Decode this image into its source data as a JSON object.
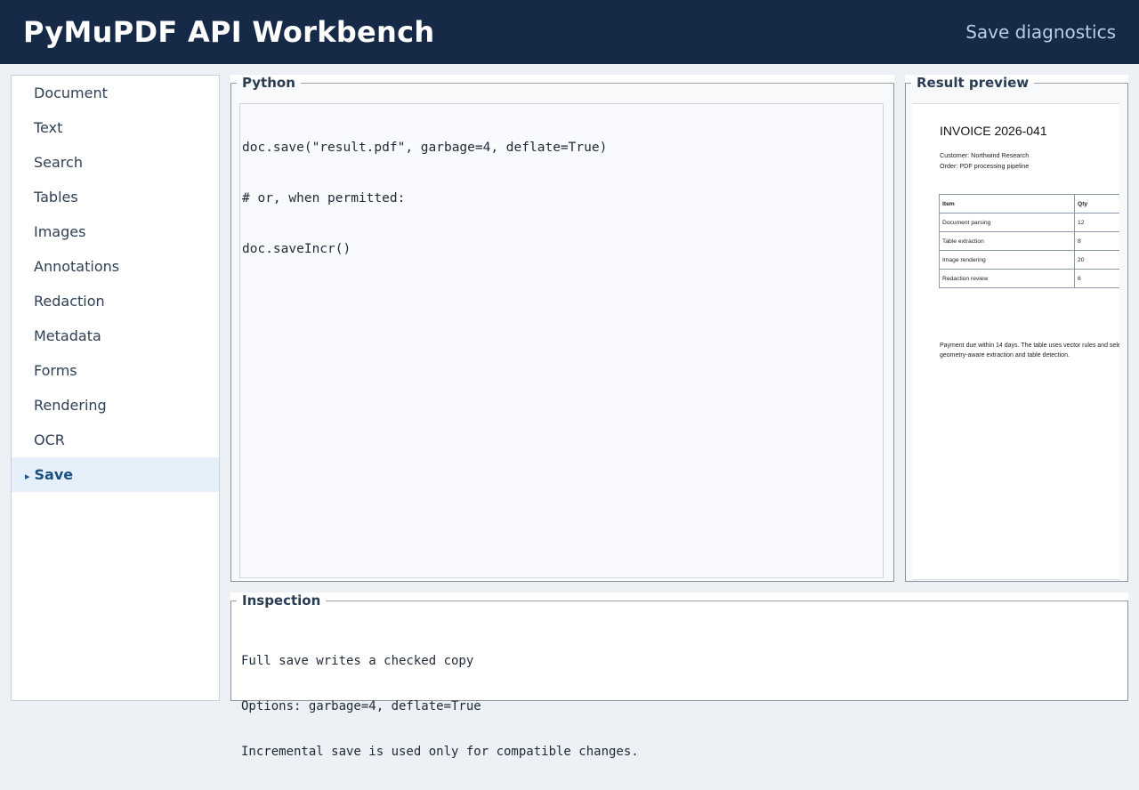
{
  "app": {
    "title": "PyMuPDF API Workbench",
    "diagnostics_label": "Save diagnostics"
  },
  "sidebar": {
    "items": [
      {
        "label": "Document"
      },
      {
        "label": "Text"
      },
      {
        "label": "Search"
      },
      {
        "label": "Tables"
      },
      {
        "label": "Images"
      },
      {
        "label": "Annotations"
      },
      {
        "label": "Redaction"
      },
      {
        "label": "Metadata"
      },
      {
        "label": "Forms"
      },
      {
        "label": "Rendering"
      },
      {
        "label": "OCR"
      },
      {
        "label": "Save",
        "active": true
      }
    ],
    "active_marker": "▸"
  },
  "python_panel": {
    "legend": "Python",
    "code_lines": [
      "doc.save(\"result.pdf\", garbage=4, deflate=True)",
      "# or, when permitted:",
      "doc.saveIncr()"
    ]
  },
  "preview_panel": {
    "legend": "Result preview",
    "invoice": {
      "title": "INVOICE 2026-041",
      "customer": "Customer: Northwind Research",
      "order": "Order: PDF processing pipeline",
      "table_headers": [
        "Item",
        "Qty"
      ],
      "rows": [
        [
          "Document parsing",
          "12"
        ],
        [
          "Table extraction",
          "8"
        ],
        [
          "Image rendering",
          "20"
        ],
        [
          "Redaction review",
          "6"
        ]
      ],
      "footer_line1": "Payment due within 14 days. The table uses vector rules and sele",
      "footer_line2": "geometry-aware extraction and table detection."
    }
  },
  "inspection_panel": {
    "legend": "Inspection",
    "lines": [
      "Full save writes a checked copy",
      "Options: garbage=4, deflate=True",
      "Incremental save is used only for compatible changes."
    ]
  },
  "colors": {
    "header_bg": "#162a47",
    "accent": "#1c4f80",
    "active_item_bg": "#e6f0fa"
  }
}
